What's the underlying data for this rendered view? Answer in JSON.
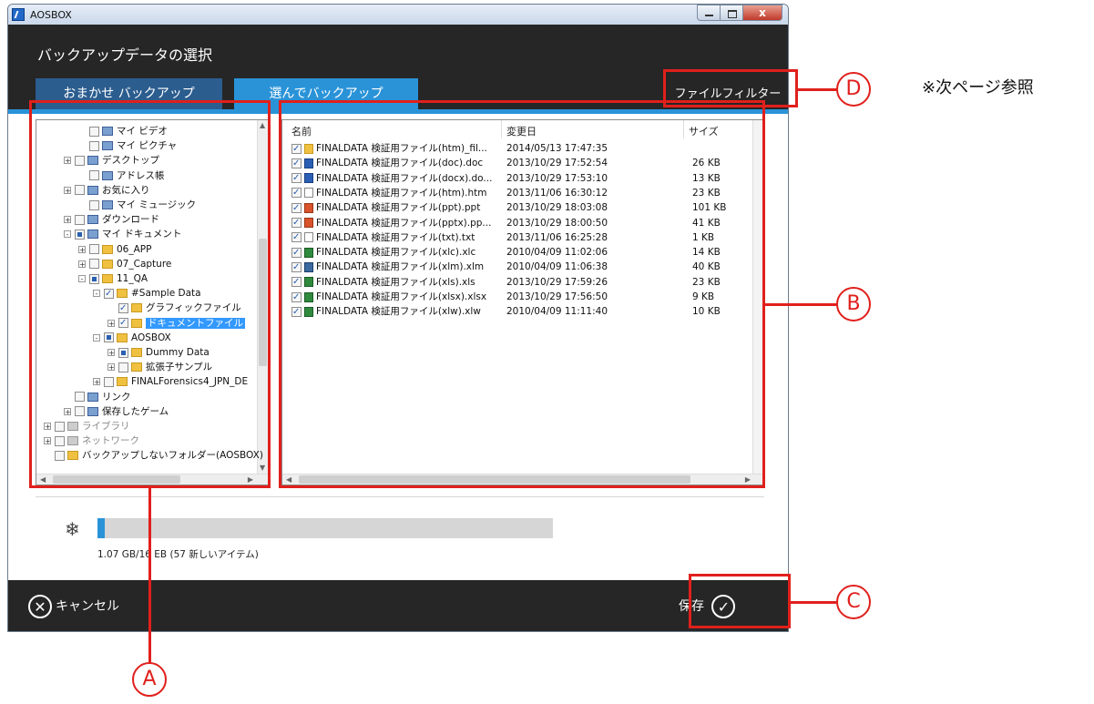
{
  "window": {
    "title": "AOSBOX",
    "close_label": "x"
  },
  "header": {
    "title": "バックアップデータの選択",
    "tabs": [
      {
        "label": "おまかせ バックアップ"
      },
      {
        "label": "選んでバックアップ"
      }
    ],
    "filter_label": "ファイルフィルター"
  },
  "tree": {
    "items": [
      {
        "label": "マイ ビデオ",
        "exp": "",
        "check": "off"
      },
      {
        "label": "マイ ピクチャ",
        "exp": "",
        "check": "off"
      },
      {
        "label": "デスクトップ",
        "exp": "+",
        "check": "off"
      },
      {
        "label": "アドレス帳",
        "exp": "",
        "check": "off"
      },
      {
        "label": "お気に入り",
        "exp": "+",
        "check": "off"
      },
      {
        "label": "マイ ミュージック",
        "exp": "",
        "check": "off"
      },
      {
        "label": "ダウンロード",
        "exp": "+",
        "check": "off"
      },
      {
        "label": "マイ ドキュメント",
        "exp": "-",
        "check": "part"
      },
      {
        "label": "06_APP",
        "exp": "+",
        "check": "off"
      },
      {
        "label": "07_Capture",
        "exp": "+",
        "check": "off"
      },
      {
        "label": "11_QA",
        "exp": "-",
        "check": "part"
      },
      {
        "label": "#Sample Data",
        "exp": "-",
        "check": "on"
      },
      {
        "label": "グラフィックファイル",
        "exp": "",
        "check": "on"
      },
      {
        "label": "ドキュメントファイル",
        "exp": "+",
        "check": "on"
      },
      {
        "label": "AOSBOX",
        "exp": "-",
        "check": "part"
      },
      {
        "label": "Dummy Data",
        "exp": "+",
        "check": "part"
      },
      {
        "label": "拡張子サンプル",
        "exp": "+",
        "check": "off"
      },
      {
        "label": "FINALForensics4_JPN_DE",
        "exp": "+",
        "check": "off"
      },
      {
        "label": "リンク",
        "exp": "",
        "check": "off"
      },
      {
        "label": "保存したゲーム",
        "exp": "+",
        "check": "off"
      },
      {
        "label": "ライブラリ",
        "exp": "+",
        "check": "off"
      },
      {
        "label": "ネットワーク",
        "exp": "+",
        "check": "off"
      },
      {
        "label": "バックアップしないフォルダー(AOSBOX)",
        "exp": "",
        "check": "off"
      }
    ]
  },
  "files": {
    "columns": {
      "name": "名前",
      "date": "変更日",
      "size": "サイズ"
    },
    "rows": [
      {
        "name": "FINALDATA 検証用ファイル(htm)_fil...",
        "date": "2014/05/13 17:47:35",
        "size": "",
        "icon": "folder"
      },
      {
        "name": "FINALDATA 検証用ファイル(doc).doc",
        "date": "2013/10/29 17:52:54",
        "size": "26 KB",
        "icon": "word"
      },
      {
        "name": "FINALDATA 検証用ファイル(docx).do...",
        "date": "2013/10/29 17:53:10",
        "size": "13 KB",
        "icon": "word"
      },
      {
        "name": "FINALDATA 検証用ファイル(htm).htm",
        "date": "2013/11/06 16:30:12",
        "size": "23 KB",
        "icon": "page"
      },
      {
        "name": "FINALDATA 検証用ファイル(ppt).ppt",
        "date": "2013/10/29 18:03:08",
        "size": "101 KB",
        "icon": "ppt"
      },
      {
        "name": "FINALDATA 検証用ファイル(pptx).pp...",
        "date": "2013/10/29 18:00:50",
        "size": "41 KB",
        "icon": "ppt"
      },
      {
        "name": "FINALDATA 検証用ファイル(txt).txt",
        "date": "2013/11/06 16:25:28",
        "size": "1 KB",
        "icon": "page"
      },
      {
        "name": "FINALDATA 検証用ファイル(xlc).xlc",
        "date": "2010/04/09 11:02:06",
        "size": "14 KB",
        "icon": "xls"
      },
      {
        "name": "FINALDATA 検証用ファイル(xlm).xlm",
        "date": "2010/04/09 11:06:38",
        "size": "40 KB",
        "icon": "xlm"
      },
      {
        "name": "FINALDATA 検証用ファイル(xls).xls",
        "date": "2013/10/29 17:59:26",
        "size": "23 KB",
        "icon": "xls"
      },
      {
        "name": "FINALDATA 検証用ファイル(xlsx).xlsx",
        "date": "2013/10/29 17:56:50",
        "size": "9 KB",
        "icon": "xls"
      },
      {
        "name": "FINALDATA 検証用ファイル(xlw).xlw",
        "date": "2010/04/09 11:11:40",
        "size": "10 KB",
        "icon": "xls"
      }
    ]
  },
  "progress": {
    "text": "1.07 GB/16 EB (57 新しいアイテム)",
    "fraction": 0.015
  },
  "footer": {
    "cancel_label": "キャンセル",
    "save_label": "保存"
  },
  "annotations": {
    "a": "A",
    "b": "B",
    "c": "C",
    "d": "D",
    "note": "※次ページ参照"
  },
  "colors": {
    "accent": "#2a93d8",
    "annotation": "#e0201c",
    "dark": "#262626"
  }
}
